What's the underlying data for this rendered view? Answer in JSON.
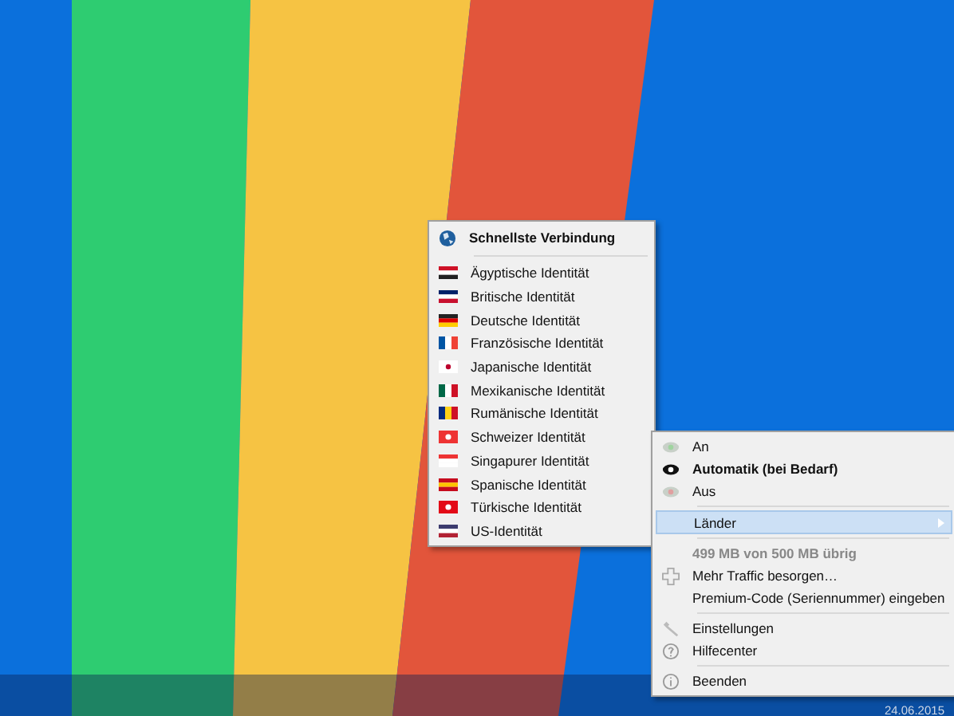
{
  "countries_menu": {
    "header": "Schnellste Verbindung",
    "items": [
      {
        "label": "Ägyptische Identität"
      },
      {
        "label": "Britische Identität"
      },
      {
        "label": "Deutsche Identität"
      },
      {
        "label": "Französische Identität"
      },
      {
        "label": "Japanische Identität"
      },
      {
        "label": "Mexikanische Identität"
      },
      {
        "label": "Rumänische Identität"
      },
      {
        "label": "Schweizer Identität"
      },
      {
        "label": "Singapurer Identität"
      },
      {
        "label": "Spanische Identität"
      },
      {
        "label": "Türkische Identität"
      },
      {
        "label": "US-Identität"
      }
    ]
  },
  "tray_menu": {
    "items": [
      {
        "kind": "mode",
        "label": "An",
        "selected": false
      },
      {
        "kind": "mode",
        "label": "Automatik (bei Bedarf)",
        "selected": true
      },
      {
        "kind": "mode",
        "label": "Aus",
        "selected": false
      },
      {
        "kind": "separator"
      },
      {
        "kind": "submenu",
        "label": "Länder",
        "expanded": true
      },
      {
        "kind": "separator"
      },
      {
        "kind": "info",
        "label": "499 MB von 500 MB übrig",
        "disabled": true
      },
      {
        "kind": "action",
        "label": "Mehr Traffic besorgen…"
      },
      {
        "kind": "action",
        "label": "Premium-Code (Seriennummer) eingeben"
      },
      {
        "kind": "separator"
      },
      {
        "kind": "action",
        "label": "Einstellungen"
      },
      {
        "kind": "action",
        "label": "Hilfecenter"
      },
      {
        "kind": "separator"
      },
      {
        "kind": "action",
        "label": "Beenden"
      }
    ]
  },
  "taskbar": {
    "date": "24.06.2015"
  }
}
